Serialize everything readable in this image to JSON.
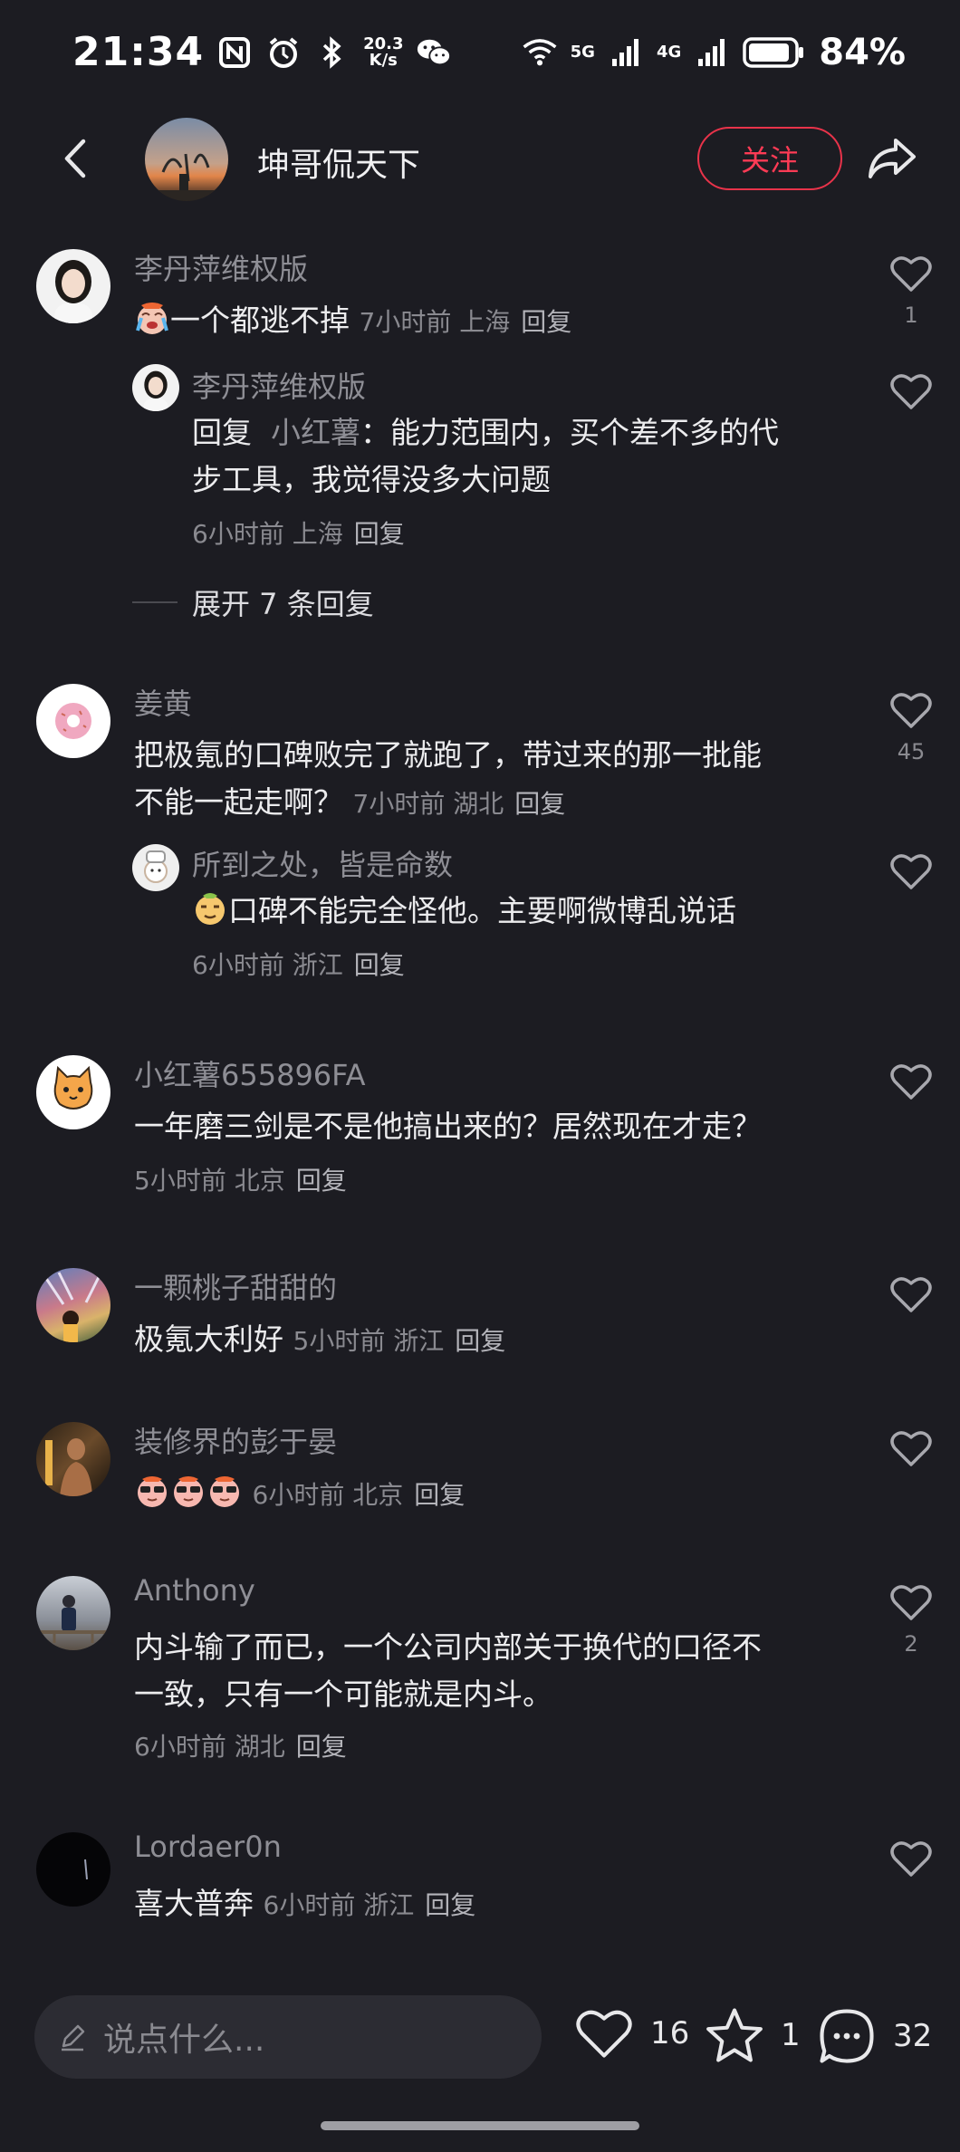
{
  "status_bar": {
    "time": "21:34",
    "net_speed_top": "20.3",
    "net_speed_bottom": "K/s",
    "sig1": "5G",
    "sig2": "4G",
    "battery": "84%"
  },
  "header": {
    "author": "坤哥侃天下",
    "follow_label": "关注"
  },
  "comments": [
    {
      "user": "李丹萍维权版",
      "text": "一个都逃不掉",
      "time": "7小时前",
      "location": "上海",
      "reply": "回复",
      "likes": "1",
      "sub": {
        "user": "李丹萍维权版",
        "prefix": "回复",
        "mention": "小红薯",
        "text_line1": "：能力范围内，买个差不多的代",
        "text_line2": "步工具，我觉得没多大问题",
        "time": "6小时前",
        "location": "上海",
        "reply": "回复"
      },
      "expand": "展开 7 条回复"
    },
    {
      "user": "姜黄",
      "text_line1": "把极氪的口碑败完了就跑了，带过来的那一批能",
      "text_line2": "不能一起走啊？",
      "time": "7小时前",
      "location": "湖北",
      "reply": "回复",
      "likes": "45",
      "sub": {
        "user": "所到之处，皆是命数",
        "text": "口碑不能完全怪他。主要啊微博乱说话",
        "time": "6小时前",
        "location": "浙江",
        "reply": "回复"
      }
    },
    {
      "user": "小红薯655896FA",
      "text": "一年磨三剑是不是他搞出来的？居然现在才走？",
      "time": "5小时前",
      "location": "北京",
      "reply": "回复"
    },
    {
      "user": "一颗桃子甜甜的",
      "text": "极氪大利好",
      "time": "5小时前",
      "location": "浙江",
      "reply": "回复"
    },
    {
      "user": "装修界的彭于晏",
      "time": "6小时前",
      "location": "北京",
      "reply": "回复"
    },
    {
      "user": "Anthony",
      "text_line1": "内斗输了而已，一个公司内部关于换代的口径不",
      "text_line2": "一致，只有一个可能就是内斗。",
      "time": "6小时前",
      "location": "湖北",
      "reply": "回复",
      "likes": "2"
    },
    {
      "user": "Lordaer0n",
      "text": "喜大普奔",
      "time": "6小时前",
      "location": "浙江",
      "reply": "回复"
    }
  ],
  "bottom_bar": {
    "placeholder": "说点什么...",
    "likes": "16",
    "stars": "1",
    "comments": "32"
  }
}
